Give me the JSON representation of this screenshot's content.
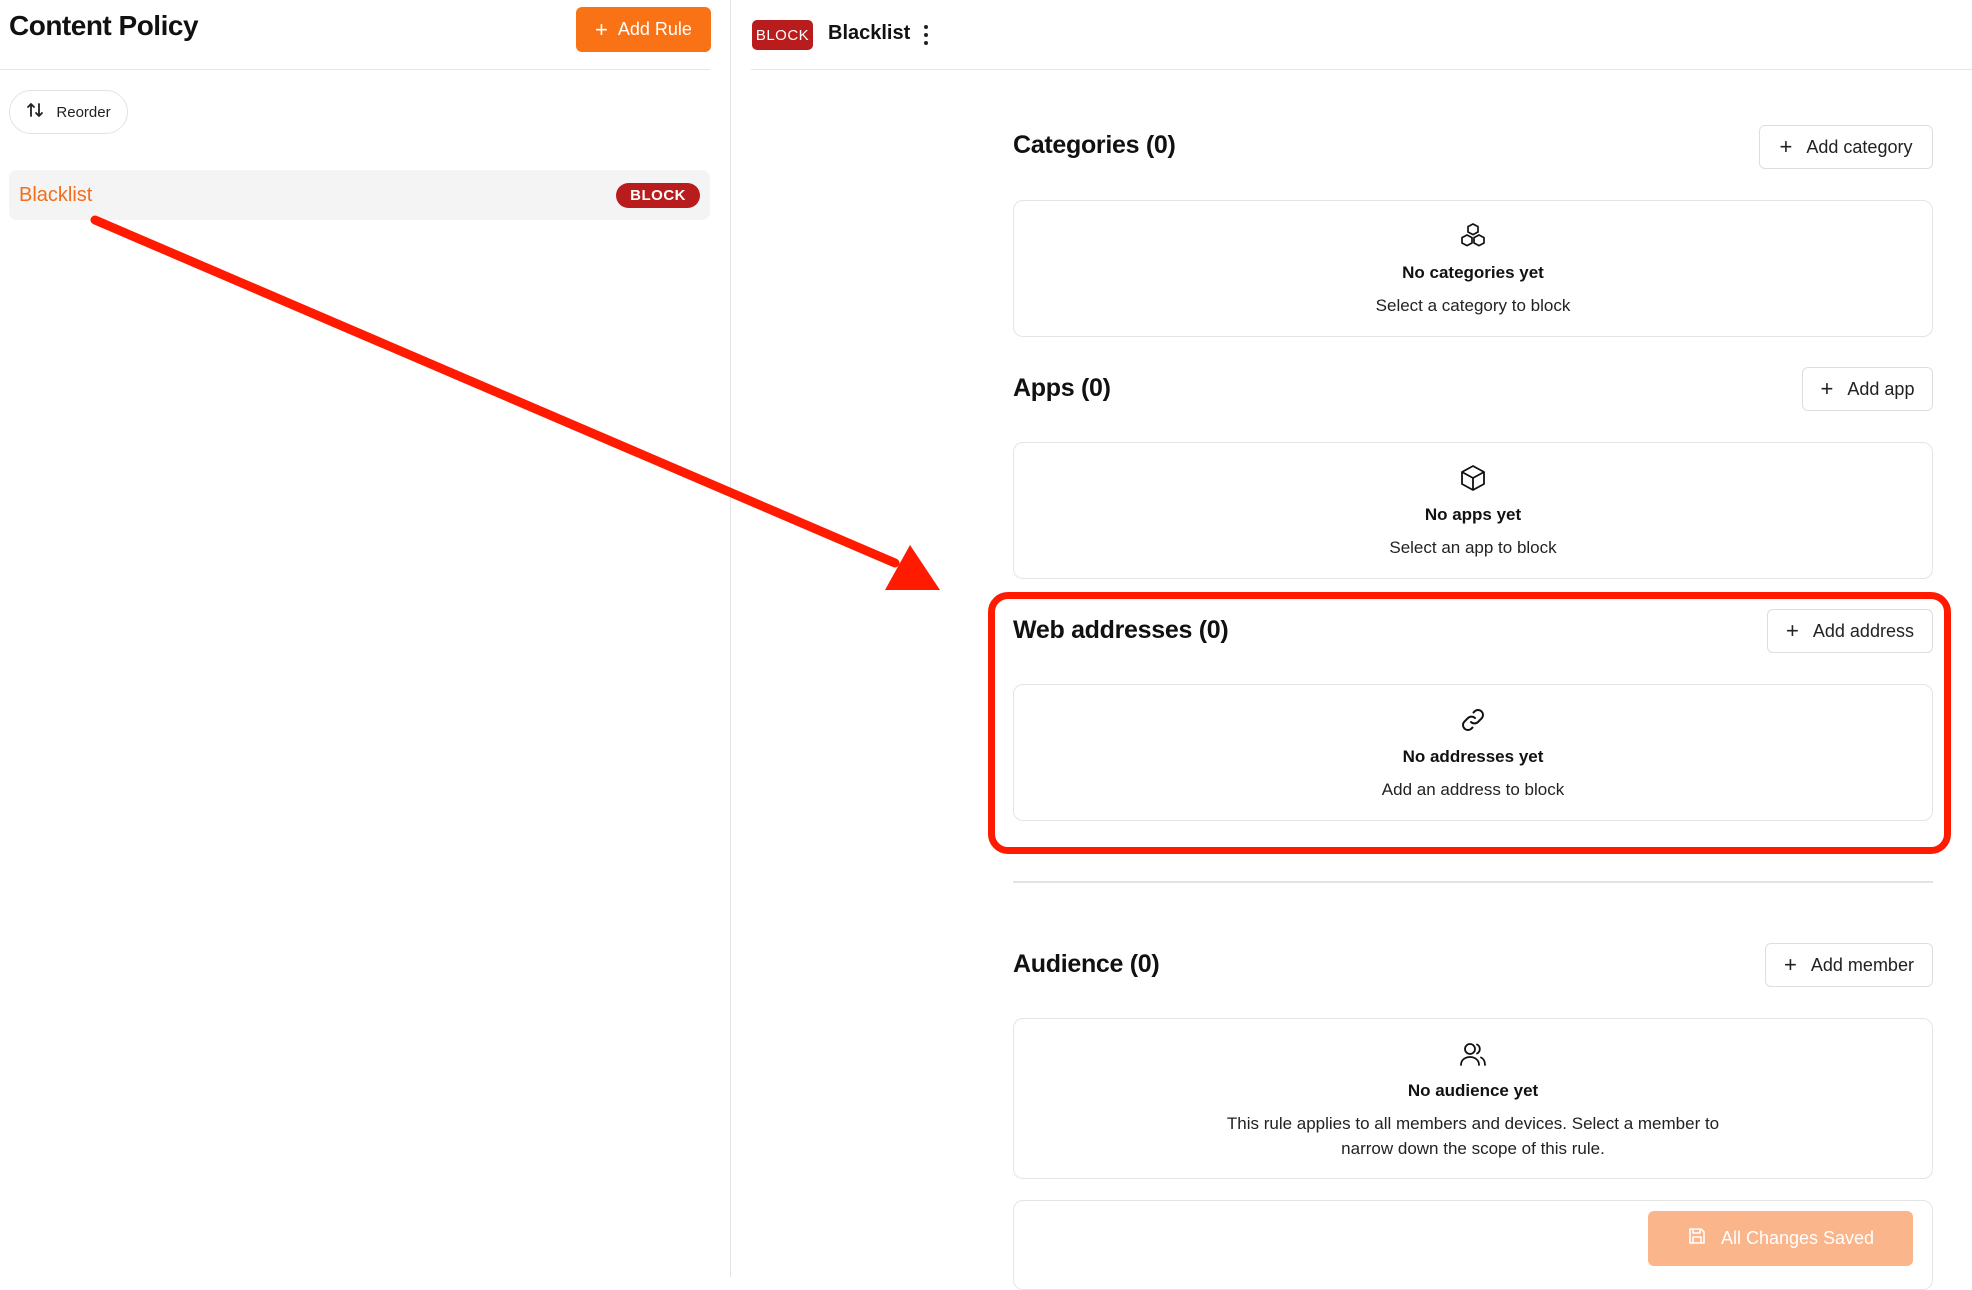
{
  "left_panel": {
    "title": "Content Policy",
    "add_rule_label": "Add Rule",
    "reorder_label": "Reorder",
    "rules": [
      {
        "name": "Blacklist",
        "badge": "BLOCK"
      }
    ]
  },
  "rule_detail": {
    "badge": "BLOCK",
    "title": "Blacklist"
  },
  "sections": {
    "categories": {
      "title": "Categories (0)",
      "add_label": "Add category",
      "empty_title": "No categories yet",
      "empty_subtitle": "Select a category to block",
      "icon": "cubes-icon"
    },
    "apps": {
      "title": "Apps (0)",
      "add_label": "Add app",
      "empty_title": "No apps yet",
      "empty_subtitle": "Select an app to block",
      "icon": "box-icon"
    },
    "web_addresses": {
      "title": "Web addresses (0)",
      "add_label": "Add address",
      "empty_title": "No addresses yet",
      "empty_subtitle": "Add an address to block",
      "icon": "link-icon"
    },
    "audience": {
      "title": "Audience (0)",
      "add_label": "Add member",
      "empty_title": "No audience yet",
      "empty_subtitle": "This rule applies to all members and devices. Select a member to narrow down the scope of this rule.",
      "icon": "users-icon"
    }
  },
  "footer": {
    "save_label": "All Changes Saved"
  },
  "colors": {
    "accent": "#f97316",
    "block_red": "#b91c1c",
    "annotation_red": "#ff1a00",
    "save_disabled": "#fbb58a"
  }
}
